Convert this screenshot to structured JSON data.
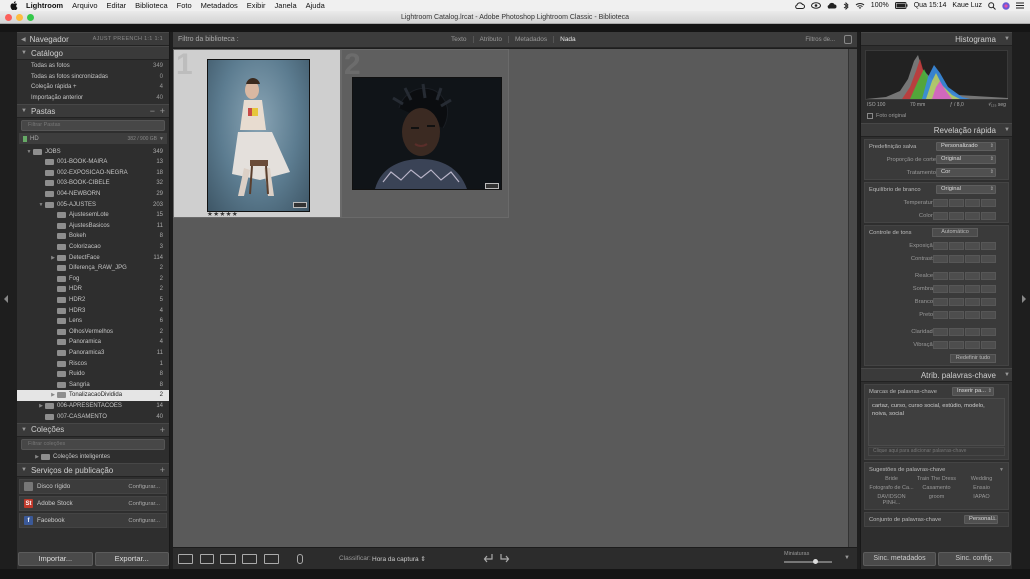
{
  "menubar": {
    "app": "Lightroom",
    "items": [
      "Arquivo",
      "Editar",
      "Biblioteca",
      "Foto",
      "Metadados",
      "Exibir",
      "Janela",
      "Ajuda"
    ],
    "battery": "100%",
    "clock": "Qua 15:14",
    "user": "Kaue Luz"
  },
  "window": {
    "title": "Lightroom Catalog.lrcat - Adobe Photoshop Lightroom Classic - Biblioteca"
  },
  "left": {
    "navigator": {
      "title": "Navegador",
      "modes": "AJUST   PREENCH   1:1   1:1"
    },
    "catalog": {
      "title": "Catálogo",
      "items": [
        {
          "label": "Todas as fotos",
          "count": "349"
        },
        {
          "label": "Todas as fotos sincronizadas",
          "count": "0"
        },
        {
          "label": "Coleção rápida +",
          "count": "4"
        },
        {
          "label": "Importação anterior",
          "count": "40"
        }
      ]
    },
    "folders": {
      "title": "Pastas",
      "search_placeholder": "Filtrar Pastas",
      "volume": {
        "name": "HD",
        "info": "382 / 900 GB"
      },
      "tree": [
        {
          "label": "JOBS",
          "count": "349",
          "depth": 0,
          "tri": "▼"
        },
        {
          "label": "001-BOOK-MAIRA",
          "count": "13",
          "depth": 1,
          "tri": ""
        },
        {
          "label": "002-EXPOSICAO-NEGRA",
          "count": "18",
          "depth": 1,
          "tri": ""
        },
        {
          "label": "003-BOOK-CIBELE",
          "count": "32",
          "depth": 1,
          "tri": ""
        },
        {
          "label": "004-NEWBORN",
          "count": "29",
          "depth": 1,
          "tri": ""
        },
        {
          "label": "005-AJUSTES",
          "count": "203",
          "depth": 1,
          "tri": "▼"
        },
        {
          "label": "AjustesemLote",
          "count": "15",
          "depth": 2,
          "tri": ""
        },
        {
          "label": "AjustesBasicos",
          "count": "11",
          "depth": 2,
          "tri": ""
        },
        {
          "label": "Bokeh",
          "count": "8",
          "depth": 2,
          "tri": ""
        },
        {
          "label": "Colorizacao",
          "count": "3",
          "depth": 2,
          "tri": ""
        },
        {
          "label": "DetectFace",
          "count": "114",
          "depth": 2,
          "tri": "▶"
        },
        {
          "label": "Diferença_RAW_JPG",
          "count": "2",
          "depth": 2,
          "tri": ""
        },
        {
          "label": "Fog",
          "count": "2",
          "depth": 2,
          "tri": ""
        },
        {
          "label": "HDR",
          "count": "2",
          "depth": 2,
          "tri": ""
        },
        {
          "label": "HDR2",
          "count": "5",
          "depth": 2,
          "tri": ""
        },
        {
          "label": "HDR3",
          "count": "4",
          "depth": 2,
          "tri": ""
        },
        {
          "label": "Lens",
          "count": "6",
          "depth": 2,
          "tri": ""
        },
        {
          "label": "OlhosVermelhos",
          "count": "2",
          "depth": 2,
          "tri": ""
        },
        {
          "label": "Panoramica",
          "count": "4",
          "depth": 2,
          "tri": ""
        },
        {
          "label": "Panoramica3",
          "count": "11",
          "depth": 2,
          "tri": ""
        },
        {
          "label": "Riscos",
          "count": "1",
          "depth": 2,
          "tri": ""
        },
        {
          "label": "Ruido",
          "count": "8",
          "depth": 2,
          "tri": ""
        },
        {
          "label": "Sangria",
          "count": "8",
          "depth": 2,
          "tri": ""
        },
        {
          "label": "TonalizacaoDividida",
          "count": "2",
          "depth": 2,
          "tri": "▶",
          "selected": true
        },
        {
          "label": "006-APRESENTACOES",
          "count": "14",
          "depth": 1,
          "tri": "▶"
        },
        {
          "label": "007-CASAMENTO",
          "count": "40",
          "depth": 1,
          "tri": ""
        }
      ]
    },
    "collections": {
      "title": "Coleções",
      "search_placeholder": "Filtrar coleções",
      "smart": "Coleções inteligentes"
    },
    "publish": {
      "title": "Serviços de publicação",
      "services": [
        {
          "label": "Disco rígido",
          "action": "Configurar...",
          "color": "#777",
          "glyph": ""
        },
        {
          "label": "Adobe Stock",
          "action": "Configurar...",
          "color": "#c0392b",
          "glyph": "St"
        },
        {
          "label": "Facebook",
          "action": "Configurar...",
          "color": "#3b5998",
          "glyph": "f"
        }
      ]
    },
    "import_label": "Importar...",
    "export_label": "Exportar..."
  },
  "center": {
    "filter": {
      "label": "Filtro da biblioteca :",
      "modes": [
        "Texto",
        "Atributo",
        "Metadados",
        "Nada"
      ],
      "active": "Nada",
      "presets": "Filtros de..."
    },
    "thumbs": [
      {
        "index": "1",
        "rating": "★★★★★"
      },
      {
        "index": "2",
        "rating": ""
      }
    ],
    "toolbar": {
      "sort_label": "Classificar:",
      "sort_value": "Hora da captura ⇕",
      "thumb_label": "Miniaturas"
    }
  },
  "right": {
    "histogram": {
      "title": "Histograma",
      "exif": [
        "ISO 100",
        "70 mm",
        "ƒ / 8,0",
        "¹⁄₁₂₅ seg"
      ],
      "original": "Foto original"
    },
    "quick": {
      "title": "Revelação rápida",
      "preset_label": "Predefinição salva",
      "preset_value": "Personalizado",
      "crop_label": "Proporção de corte",
      "crop_value": "Original",
      "treat_label": "Tratamento",
      "treat_value": "Cor",
      "wb_label": "Equilíbrio de branco",
      "wb_value": "Original",
      "temp_label": "Temperatura",
      "tint_label": "Colorir",
      "tone_label": "Controle de tons",
      "auto_label": "Automático",
      "exposure_label": "Exposição",
      "contrast_label": "Contraste",
      "highlights_label": "Realces",
      "shadows_label": "Sombras",
      "whites_label": "Brancos",
      "blacks_label": "Pretos",
      "clarity_label": "Claridade",
      "vibrance_label": "Vibração",
      "reset_label": "Redefinir tudo"
    },
    "keywords": {
      "title": "Atrib. palavras-chave",
      "tags_label": "Marcas de palavras-chave",
      "tags_mode": "Inserir pa...",
      "text": "cartaz, curso, curso social, estúdio, modelo, noiva, social",
      "add_placeholder": "Clique aqui para adicionar palavras-chave",
      "sugg_title": "Sugestões de palavras-chave",
      "suggestions": [
        "Bride",
        "Train The Dress",
        "Wedding",
        "Fotografo de Ca...",
        "Casamento",
        "Ensaio",
        "DAVIDSON PINH...",
        "groom",
        "IAPAO"
      ],
      "set_label": "Conjunto de palavras-chave",
      "set_value": "Personal..."
    },
    "sync_meta": "Sinc. metadados",
    "sync_settings": "Sinc. config."
  }
}
